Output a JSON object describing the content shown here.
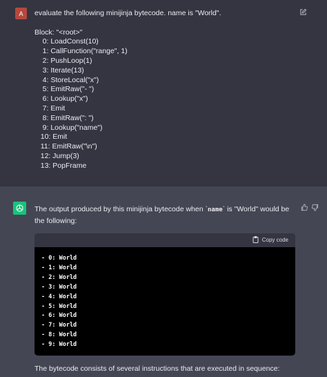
{
  "user": {
    "avatar_letter": "A",
    "prompt": "evaluate the following minijinja bytecode. name is \"World\".\n\nBlock: \"<root>\"\n    0: LoadConst(10)\n    1: CallFunction(\"range\", 1)\n    2: PushLoop(1)\n    3: Iterate(13)\n    4: StoreLocal(\"x\")\n    5: EmitRaw(\"- \")\n    6: Lookup(\"x\")\n    7: Emit\n    8: EmitRaw(\": \")\n    9: Lookup(\"name\")\n   10: Emit\n   11: EmitRaw(\"\\n\")\n   12: Jump(3)\n   13: PopFrame"
  },
  "assistant": {
    "intro_before": "The output produced by this minijinja bytecode when `",
    "intro_code": "name",
    "intro_after": "` is \"World\" would be the following:",
    "copy_label": "Copy code",
    "code_lines": [
      "- 0: World",
      "- 1: World",
      "- 2: World",
      "- 3: World",
      "- 4: World",
      "- 5: World",
      "- 6: World",
      "- 7: World",
      "- 8: World",
      "- 9: World"
    ],
    "outro": "The bytecode consists of several instructions that are executed in sequence:"
  },
  "colors": {
    "user_bg": "#343541",
    "assistant_bg": "#444654",
    "user_avatar": "#b5483d",
    "assistant_avatar": "#19c37d"
  }
}
